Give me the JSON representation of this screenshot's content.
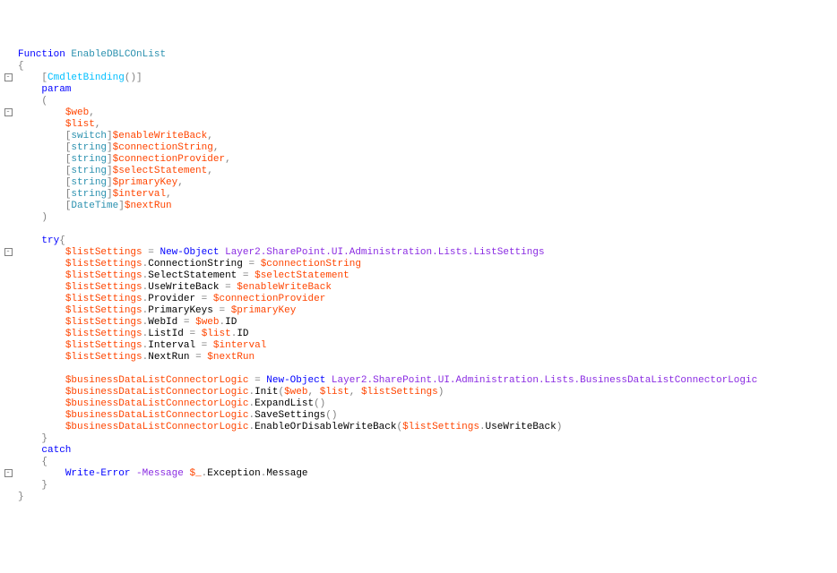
{
  "keywords": {
    "function": "Function",
    "param": "param",
    "try": "try",
    "catch": "catch",
    "switch": "switch",
    "string": "string",
    "datetime": "DateTime",
    "newobject": "New-Object",
    "writeerror": "Write-Error",
    "message_flag": "-Message"
  },
  "fn_name": "EnableDBLCOnList",
  "attr": "CmdletBinding",
  "params": {
    "web": "$web",
    "list": "$list",
    "enableWriteBack": "$enableWriteBack",
    "connectionString": "$connectionString",
    "connectionProvider": "$connectionProvider",
    "selectStatement": "$selectStatement",
    "primaryKey": "$primaryKey",
    "interval": "$interval",
    "nextRun": "$nextRun"
  },
  "vars": {
    "listSettings": "$listSettings",
    "bdlc": "$businessDataListConnectorLogic",
    "exc": "$_"
  },
  "types": {
    "listSettings": "Layer2.SharePoint.UI.Administration.Lists.ListSettings",
    "bdlc": "Layer2.SharePoint.UI.Administration.Lists.BusinessDataListConnectorLogic"
  },
  "members": {
    "ConnectionString": "ConnectionString",
    "SelectStatement": "SelectStatement",
    "UseWriteBack": "UseWriteBack",
    "Provider": "Provider",
    "PrimaryKeys": "PrimaryKeys",
    "WebId": "WebId",
    "ListId": "ListId",
    "Interval": "Interval",
    "NextRun": "NextRun",
    "ID": "ID",
    "Init": "Init",
    "ExpandList": "ExpandList",
    "SaveSettings": "SaveSettings",
    "EnableOrDisableWriteBack": "EnableOrDisableWriteBack",
    "Exception": "Exception",
    "Message": "Message"
  }
}
